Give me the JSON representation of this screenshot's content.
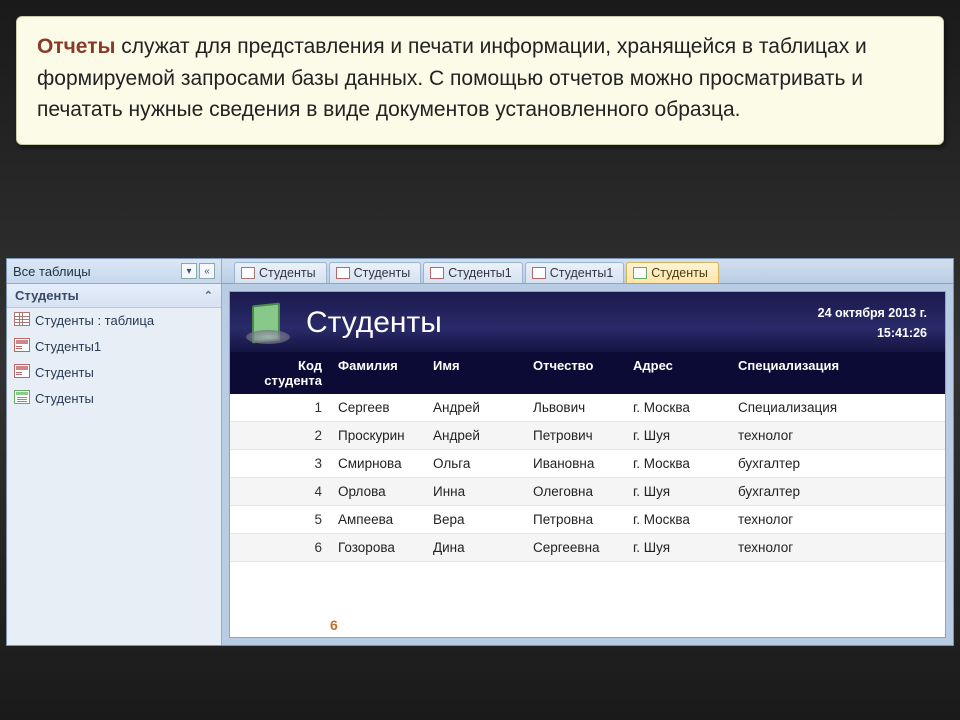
{
  "description": {
    "keyword": "Отчеты",
    "rest": " служат для представления и печати информации, хранящейся в таблицах и формируемой запросами базы данных. С помощью отчетов можно просматривать и печатать нужные сведения в виде документов установленного образца."
  },
  "nav": {
    "header": "Все таблицы",
    "group": "Студенты",
    "items": [
      {
        "label": "Студенты : таблица",
        "icon": "table"
      },
      {
        "label": "Студенты1",
        "icon": "form"
      },
      {
        "label": "Студенты",
        "icon": "form"
      },
      {
        "label": "Студенты",
        "icon": "report"
      }
    ]
  },
  "tabs": [
    {
      "label": "Студенты",
      "icon": "table",
      "active": false
    },
    {
      "label": "Студенты",
      "icon": "form",
      "active": false
    },
    {
      "label": "Студенты1",
      "icon": "form",
      "active": false
    },
    {
      "label": "Студенты1",
      "icon": "form",
      "active": false
    },
    {
      "label": "Студенты",
      "icon": "report",
      "active": true
    }
  ],
  "report": {
    "title": "Студенты",
    "date": "24 октября 2013 г.",
    "time": "15:41:26",
    "columns": {
      "id": "Код студента",
      "ln": "Фамилия",
      "fn": "Имя",
      "mn": "Отчество",
      "ad": "Адрес",
      "sp": "Специализация"
    },
    "rows": [
      {
        "id": "1",
        "ln": "Сергеев",
        "fn": "Андрей",
        "mn": "Львович",
        "ad": "г. Москва",
        "sp": "Специализация"
      },
      {
        "id": "2",
        "ln": "Проскурин",
        "fn": "Андрей",
        "mn": "Петрович",
        "ad": "г. Шуя",
        "sp": "технолог"
      },
      {
        "id": "3",
        "ln": "Смирнова",
        "fn": "Ольга",
        "mn": "Ивановна",
        "ad": "г. Москва",
        "sp": "бухгалтер"
      },
      {
        "id": "4",
        "ln": "Орлова",
        "fn": "Инна",
        "mn": "Олеговна",
        "ad": "г. Шуя",
        "sp": "бухгалтер"
      },
      {
        "id": "5",
        "ln": "Ампеева",
        "fn": "Вера",
        "mn": "Петровна",
        "ad": "г. Москва",
        "sp": "технолог"
      },
      {
        "id": "6",
        "ln": "Гозорова",
        "fn": "Дина",
        "mn": "Сергеевна",
        "ad": "г. Шуя",
        "sp": "технолог"
      }
    ],
    "total": "6"
  }
}
